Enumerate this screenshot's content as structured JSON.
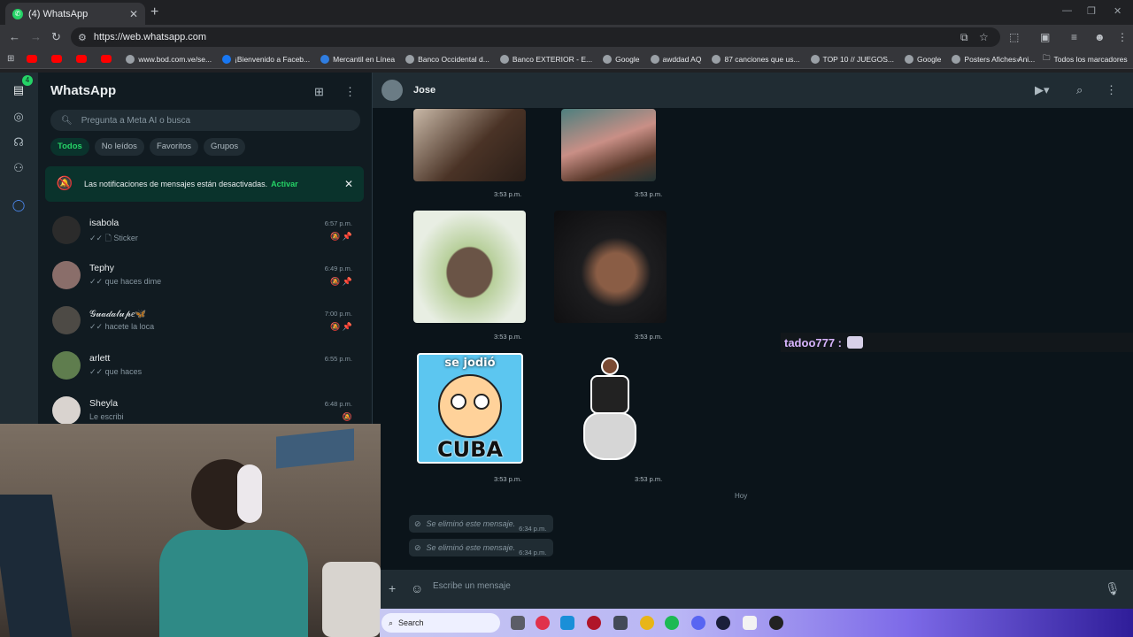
{
  "browser": {
    "tab_title": "(4) WhatsApp",
    "tab_favicon_badge": "4",
    "url": "https://web.whatsapp.com",
    "bookmarks": [
      {
        "label": "",
        "icon": "youtube"
      },
      {
        "label": "",
        "icon": "youtube"
      },
      {
        "label": "",
        "icon": "youtube"
      },
      {
        "label": "",
        "icon": "youtube"
      },
      {
        "label": "www.bod.com.ve/se...",
        "icon": "globe"
      },
      {
        "label": "¡Bienvenido a Faceb...",
        "icon": "facebook"
      },
      {
        "label": "Mercantil en Línea",
        "icon": "mercantil"
      },
      {
        "label": "Banco Occidental d...",
        "icon": "globe"
      },
      {
        "label": "Banco EXTERIOR - E...",
        "icon": "globe"
      },
      {
        "label": "Google",
        "icon": "globe"
      },
      {
        "label": "awddad AQ",
        "icon": "globe"
      },
      {
        "label": "87 canciones que us...",
        "icon": "globe"
      },
      {
        "label": "TOP 10 // JUEGOS...",
        "icon": "globe"
      },
      {
        "label": "Google",
        "icon": "globe"
      },
      {
        "label": "Posters Afiches Ani...",
        "icon": "globe"
      }
    ],
    "all_bookmarks": "Todos los marcadores"
  },
  "sidebar": {
    "app_title": "WhatsApp",
    "rail_badge": "4",
    "search_placeholder": "Pregunta a Meta AI o busca",
    "filters": [
      "Todos",
      "No leídos",
      "Favoritos",
      "Grupos"
    ],
    "notice": {
      "text": "Las notificaciones de mensajes están desactivadas.",
      "action": "Activar"
    },
    "chats": [
      {
        "name": "isabola",
        "preview": "✓✓ 🗋 Sticker",
        "time": "6:57 p.m.",
        "icons": "🔕 📌",
        "avatar_color": "#2b2b2b"
      },
      {
        "name": "Tephy",
        "preview": "✓✓ que haces dime",
        "time": "6:49 p.m.",
        "icons": "🔕 📌",
        "avatar_color": "#8a6e6a"
      },
      {
        "name": "𝒢𝓊𝒶𝒹𝒶𝓁𝓊𝓅𝑒🦋",
        "preview": "✓✓ hacete la loca",
        "time": "7:00 p.m.",
        "icons": "🔕 📌",
        "avatar_color": "#4d4a45"
      },
      {
        "name": "arlett",
        "preview": "✓✓ que haces",
        "time": "6:55 p.m.",
        "icons": "",
        "avatar_color": "#5f7d4e"
      },
      {
        "name": "Sheyla",
        "preview": "Le escribi",
        "time": "6:48 p.m.",
        "icons": "🔕",
        "avatar_color": "#d9d3cf"
      }
    ]
  },
  "chat": {
    "contact_name": "Jose",
    "media_times": [
      "3:53 p.m.",
      "3:53 p.m.",
      "3:53 p.m.",
      "3:53 p.m.",
      "3:53 p.m.",
      "3:53 p.m."
    ],
    "sticker_top_text": "se jodió",
    "sticker_bottom_text": "CUBA",
    "date_divider": "Hoy",
    "deleted_messages": [
      {
        "text": "Se eliminó este mensaje.",
        "time": "6:34 p.m."
      },
      {
        "text": "Se eliminó este mensaje.",
        "time": "6:34 p.m."
      }
    ],
    "compose_placeholder": "Escribe un mensaje"
  },
  "stream_overlay": {
    "chat_user": "tadoo777 :"
  },
  "taskbar": {
    "search_label": "Search"
  },
  "colors": {
    "accent": "#25d366",
    "panel": "#111b21",
    "header": "#202c33",
    "chat_bg": "#0b141a"
  }
}
